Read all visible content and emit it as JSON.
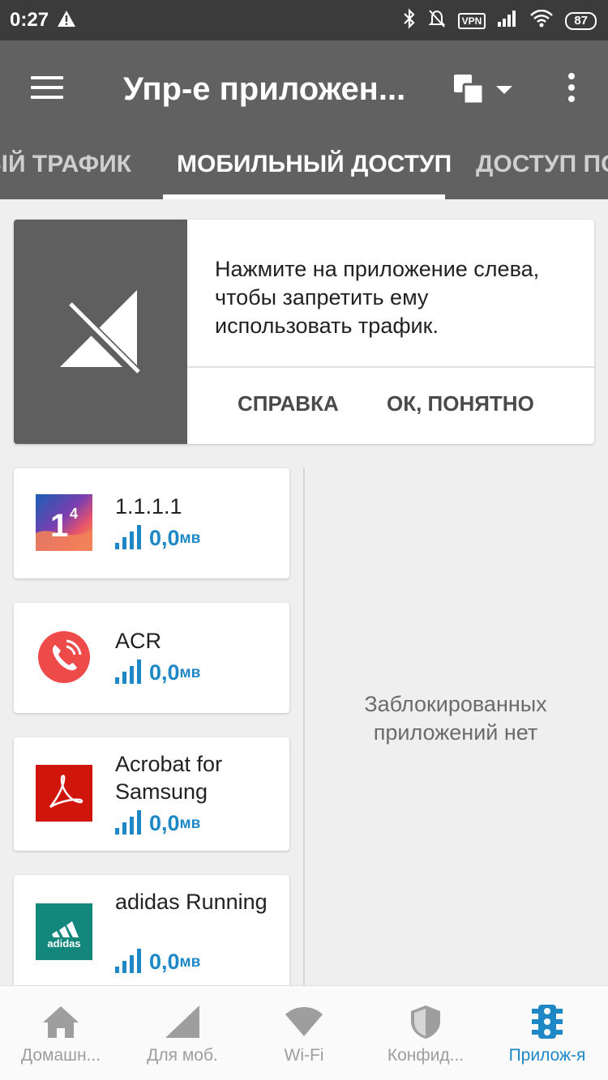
{
  "status_bar": {
    "time": "0:27",
    "vpn_label": "VPN",
    "battery": "87"
  },
  "app_bar": {
    "title": "Упр-е приложен...",
    "tabs": [
      {
        "label": "ЫЙ ТРАФИК",
        "active": false
      },
      {
        "label": "МОБИЛЬНЫЙ ДОСТУП",
        "active": true
      },
      {
        "label": "ДОСТУП ПО",
        "active": false
      }
    ]
  },
  "hint_card": {
    "text": "Нажмите на приложение слева, чтобы запретить ему использовать трафик.",
    "help_button": "СПРАВКА",
    "ok_button": "ОК, ПОНЯТНО"
  },
  "apps": [
    {
      "name": "1.1.1.1",
      "usage": "0,0",
      "unit": "мв",
      "icon": "cloudflare-1111-icon"
    },
    {
      "name": "ACR",
      "usage": "0,0",
      "unit": "мв",
      "icon": "acr-phone-icon"
    },
    {
      "name": "Acrobat for Samsung",
      "usage": "0,0",
      "unit": "мв",
      "icon": "acrobat-icon"
    },
    {
      "name": "adidas Running",
      "usage": "0,0",
      "unit": "мв",
      "icon": "adidas-icon"
    }
  ],
  "blocked_panel": {
    "empty_text": "Заблокированных приложений нет"
  },
  "bottom_nav": [
    {
      "label": "Домашн...",
      "icon": "home-icon",
      "active": false
    },
    {
      "label": "Для моб.",
      "icon": "cellular-icon",
      "active": false
    },
    {
      "label": "Wi-Fi",
      "icon": "wifi-icon",
      "active": false
    },
    {
      "label": "Конфид...",
      "icon": "shield-icon",
      "active": false
    },
    {
      "label": "Прилож-я",
      "icon": "traffic-light-icon",
      "active": true
    }
  ],
  "colors": {
    "accent": "#1e88c7",
    "app_bar": "#616161",
    "status_bar": "#3b3b3b"
  }
}
